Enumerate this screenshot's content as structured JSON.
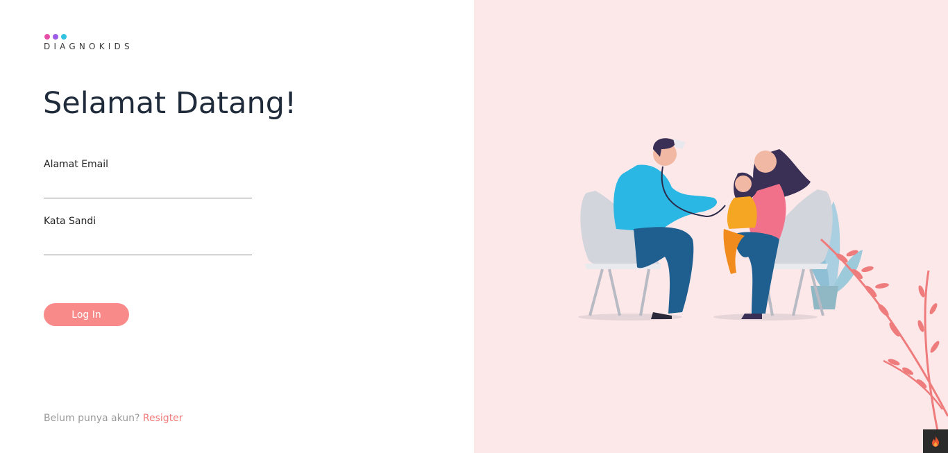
{
  "brand": {
    "name": "DIAGNOKIDS",
    "dot_colors": [
      "#e64fa8",
      "#9b5de5",
      "#33c3e0"
    ]
  },
  "heading": "Selamat Datang!",
  "form": {
    "email_label": "Alamat Email",
    "email_value": "",
    "password_label": "Kata Sandi",
    "password_value": "",
    "login_label": "Log In"
  },
  "footer": {
    "prompt": "Belum punya akun?",
    "register_label": "Resigter"
  },
  "colors": {
    "accent": "#f88a8a",
    "panel_background": "#fde8e9",
    "heading": "#1f2b3a"
  },
  "icons": {
    "corner_badge": "flame-icon"
  }
}
